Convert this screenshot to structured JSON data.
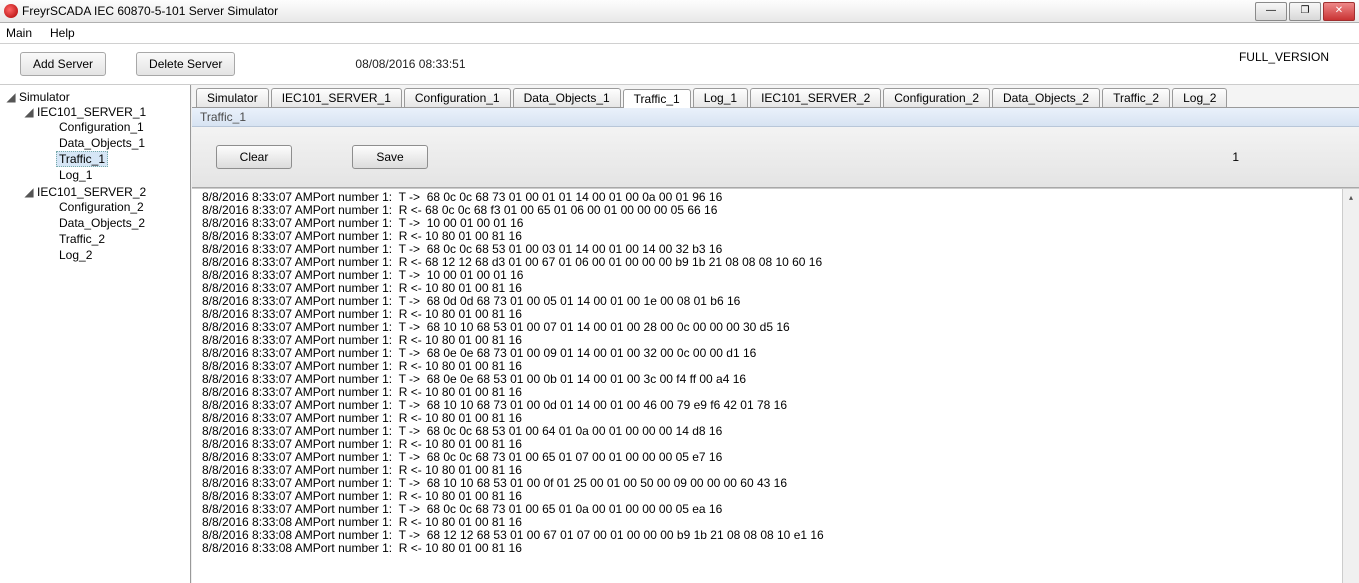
{
  "window": {
    "title": "FreyrSCADA IEC 60870-5-101 Server Simulator"
  },
  "menu": {
    "main": "Main",
    "help": "Help"
  },
  "toolbar": {
    "add": "Add Server",
    "delete": "Delete Server",
    "timestamp": "08/08/2016 08:33:51",
    "version": "FULL_VERSION"
  },
  "tree": {
    "root": "Simulator",
    "s1": {
      "name": "IEC101_SERVER_1",
      "conf": "Configuration_1",
      "data": "Data_Objects_1",
      "traffic": "Traffic_1",
      "log": "Log_1"
    },
    "s2": {
      "name": "IEC101_SERVER_2",
      "conf": "Configuration_2",
      "data": "Data_Objects_2",
      "traffic": "Traffic_2",
      "log": "Log_2"
    }
  },
  "tabs": {
    "t0": "Simulator",
    "t1": "IEC101_SERVER_1",
    "t2": "Configuration_1",
    "t3": "Data_Objects_1",
    "t4": "Traffic_1",
    "t5": "Log_1",
    "t6": "IEC101_SERVER_2",
    "t7": "Configuration_2",
    "t8": "Data_Objects_2",
    "t9": "Traffic_2",
    "t10": "Log_2"
  },
  "panel": {
    "header": "Traffic_1",
    "clear": "Clear",
    "save": "Save",
    "count": "1"
  },
  "log": [
    "8/8/2016 8:33:07 AMPort number 1:  T ->  68 0c 0c 68 73 01 00 01 01 14 00 01 00 0a 00 01 96 16",
    "8/8/2016 8:33:07 AMPort number 1:  R <- 68 0c 0c 68 f3 01 00 65 01 06 00 01 00 00 00 05 66 16",
    "8/8/2016 8:33:07 AMPort number 1:  T ->  10 00 01 00 01 16",
    "8/8/2016 8:33:07 AMPort number 1:  R <- 10 80 01 00 81 16",
    "8/8/2016 8:33:07 AMPort number 1:  T ->  68 0c 0c 68 53 01 00 03 01 14 00 01 00 14 00 32 b3 16",
    "8/8/2016 8:33:07 AMPort number 1:  R <- 68 12 12 68 d3 01 00 67 01 06 00 01 00 00 00 b9 1b 21 08 08 08 10 60 16",
    "8/8/2016 8:33:07 AMPort number 1:  T ->  10 00 01 00 01 16",
    "8/8/2016 8:33:07 AMPort number 1:  R <- 10 80 01 00 81 16",
    "8/8/2016 8:33:07 AMPort number 1:  T ->  68 0d 0d 68 73 01 00 05 01 14 00 01 00 1e 00 08 01 b6 16",
    "8/8/2016 8:33:07 AMPort number 1:  R <- 10 80 01 00 81 16",
    "8/8/2016 8:33:07 AMPort number 1:  T ->  68 10 10 68 53 01 00 07 01 14 00 01 00 28 00 0c 00 00 00 30 d5 16",
    "8/8/2016 8:33:07 AMPort number 1:  R <- 10 80 01 00 81 16",
    "8/8/2016 8:33:07 AMPort number 1:  T ->  68 0e 0e 68 73 01 00 09 01 14 00 01 00 32 00 0c 00 00 d1 16",
    "8/8/2016 8:33:07 AMPort number 1:  R <- 10 80 01 00 81 16",
    "8/8/2016 8:33:07 AMPort number 1:  T ->  68 0e 0e 68 53 01 00 0b 01 14 00 01 00 3c 00 f4 ff 00 a4 16",
    "8/8/2016 8:33:07 AMPort number 1:  R <- 10 80 01 00 81 16",
    "8/8/2016 8:33:07 AMPort number 1:  T ->  68 10 10 68 73 01 00 0d 01 14 00 01 00 46 00 79 e9 f6 42 01 78 16",
    "8/8/2016 8:33:07 AMPort number 1:  R <- 10 80 01 00 81 16",
    "8/8/2016 8:33:07 AMPort number 1:  T ->  68 0c 0c 68 53 01 00 64 01 0a 00 01 00 00 00 14 d8 16",
    "8/8/2016 8:33:07 AMPort number 1:  R <- 10 80 01 00 81 16",
    "8/8/2016 8:33:07 AMPort number 1:  T ->  68 0c 0c 68 73 01 00 65 01 07 00 01 00 00 00 05 e7 16",
    "8/8/2016 8:33:07 AMPort number 1:  R <- 10 80 01 00 81 16",
    "8/8/2016 8:33:07 AMPort number 1:  T ->  68 10 10 68 53 01 00 0f 01 25 00 01 00 50 00 09 00 00 00 60 43 16",
    "8/8/2016 8:33:07 AMPort number 1:  R <- 10 80 01 00 81 16",
    "8/8/2016 8:33:07 AMPort number 1:  T ->  68 0c 0c 68 73 01 00 65 01 0a 00 01 00 00 00 05 ea 16",
    "8/8/2016 8:33:08 AMPort number 1:  R <- 10 80 01 00 81 16",
    "8/8/2016 8:33:08 AMPort number 1:  T ->  68 12 12 68 53 01 00 67 01 07 00 01 00 00 00 b9 1b 21 08 08 08 10 e1 16",
    "8/8/2016 8:33:08 AMPort number 1:  R <- 10 80 01 00 81 16"
  ]
}
